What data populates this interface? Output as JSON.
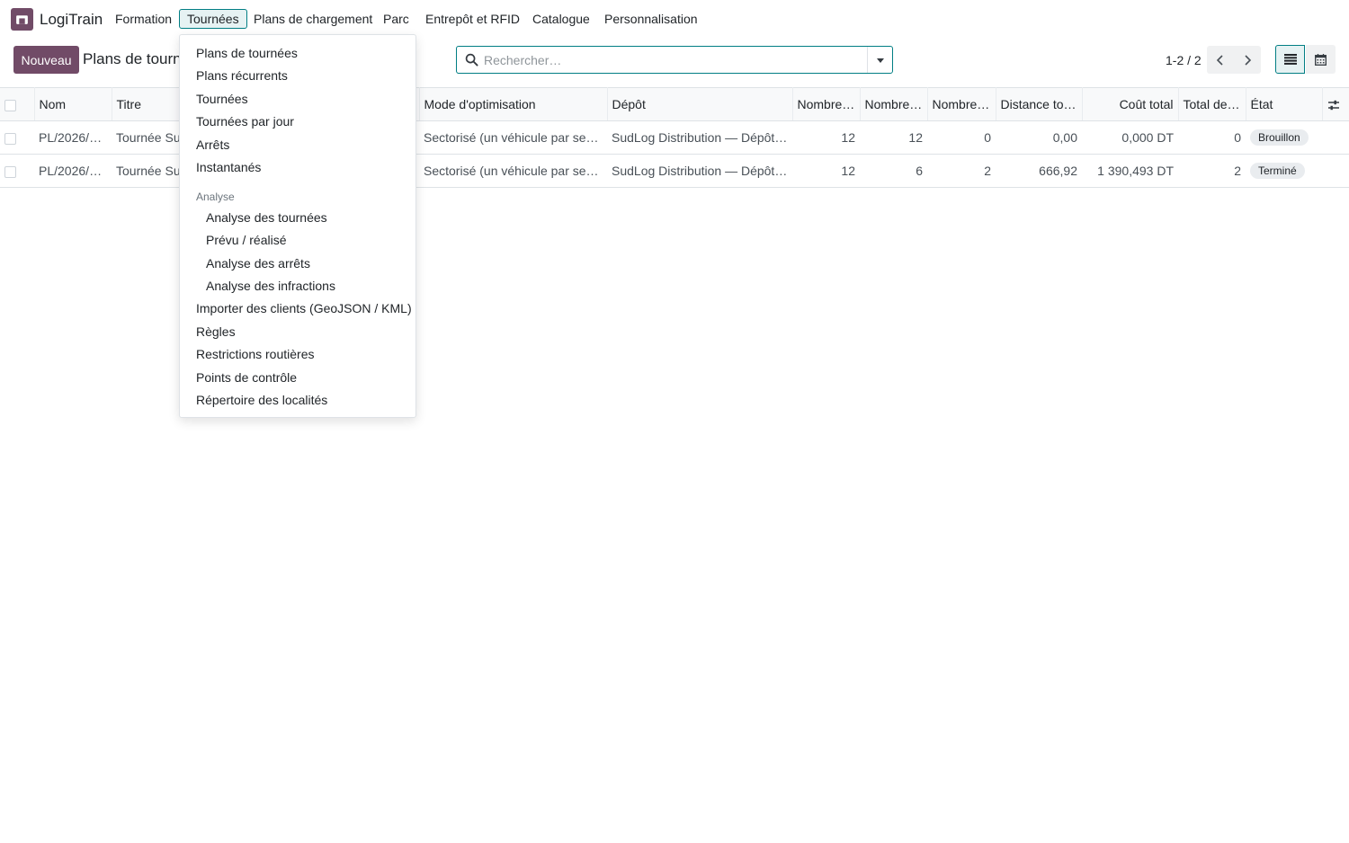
{
  "app": {
    "name": "LogiTrain"
  },
  "nav": {
    "items": [
      {
        "label": "Formation"
      },
      {
        "label": "Tournées"
      },
      {
        "label": "Plans de chargement"
      },
      {
        "label": "Parc"
      },
      {
        "label": "Entrepôt et RFID"
      },
      {
        "label": "Catalogue"
      },
      {
        "label": "Personnalisation"
      }
    ]
  },
  "control": {
    "new_label": "Nouveau",
    "breadcrumb": "Plans de tournées",
    "search_placeholder": "Rechercher…",
    "pager": "1-2 / 2"
  },
  "dropdown": {
    "items": [
      "Plans de tournées",
      "Plans récurrents",
      "Tournées",
      "Tournées par jour",
      "Arrêts",
      "Instantanés"
    ],
    "analysis_header": "Analyse",
    "analysis_items": [
      "Analyse des tournées",
      "Prévu / réalisé",
      "Analyse des arrêts",
      "Analyse des infractions"
    ],
    "bottom_items": [
      "Importer des clients (GeoJSON / KML)",
      "Règles",
      "Restrictions routières",
      "Points de contrôle",
      "Répertoire des localités"
    ]
  },
  "table": {
    "columns": [
      "Nom",
      "Titre",
      "Mode d'optimisation",
      "Dépôt",
      "Nombre …",
      "Nombre …",
      "Nombre …",
      "Distance tot…",
      "Coût total",
      "Total de…",
      "État"
    ],
    "rows": [
      {
        "nom": "PL/2026/0…",
        "titre": "Tournée Sud",
        "mode": "Sectorisé (un véhicule par secte…",
        "depot": "SudLog Distribution — Dépôt S…",
        "n1": "12",
        "n2": "12",
        "n3": "0",
        "distance": "0,00",
        "cout": "0,000 DT",
        "total": "0",
        "etat": "Brouillon"
      },
      {
        "nom": "PL/2026/0…",
        "titre": "Tournée Sud",
        "mode": "Sectorisé (un véhicule par secte…",
        "depot": "SudLog Distribution — Dépôt S…",
        "n1": "12",
        "n2": "6",
        "n3": "2",
        "distance": "666,92",
        "cout": "1 390,493 DT",
        "total": "2",
        "etat": "Terminé"
      }
    ]
  },
  "colors": {
    "brand": "#714B67",
    "accent": "#017e84"
  }
}
